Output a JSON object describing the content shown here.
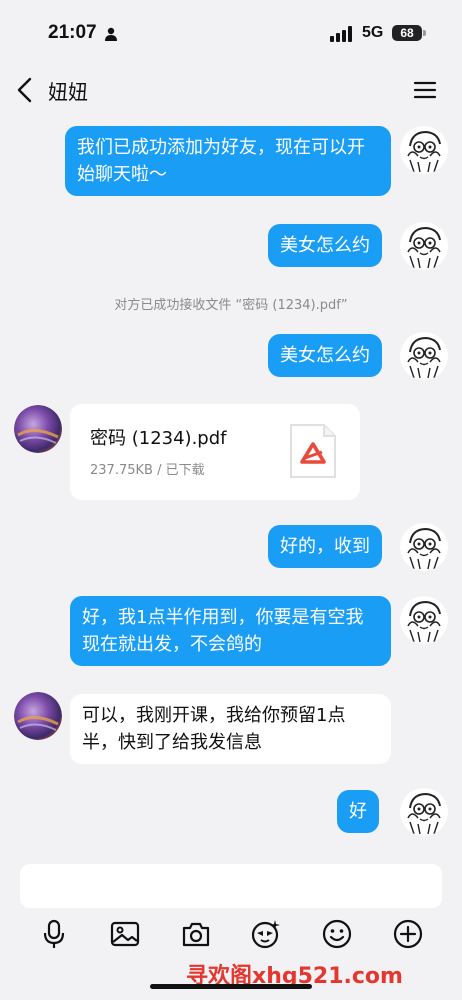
{
  "status_bar": {
    "time": "21:07",
    "network": "5G",
    "battery": "68"
  },
  "header": {
    "title": "妞妞"
  },
  "messages": [
    {
      "text": "我们已成功添加为好友，现在可以开始聊天啦～"
    },
    {
      "text": "美女怎么约"
    },
    {
      "text": "对方已成功接收文件 “密码 (1234).pdf”"
    },
    {
      "text": "美女怎么约"
    },
    {
      "file_name": "密码 (1234).pdf",
      "file_meta": "237.75KB / 已下载"
    },
    {
      "text": "好的，收到"
    },
    {
      "text": "好，我1点半作用到，你要是有空我现在就出发，不会鸽的"
    },
    {
      "text": "可以，我刚开课，我给你预留1点半，快到了给我发信息"
    },
    {
      "text": "好"
    }
  ],
  "input": {
    "placeholder": ""
  },
  "toolbar": [
    "microphone-icon",
    "image-icon",
    "camera-icon",
    "sticker-icon",
    "emoji-icon",
    "plus-icon"
  ],
  "watermark": "寻欢阁xhg521.com",
  "colors": {
    "outgoing_bubble": "#1a9df5",
    "incoming_bubble": "#ffffff",
    "background": "#f2f2f4",
    "watermark": "#e3372f"
  }
}
